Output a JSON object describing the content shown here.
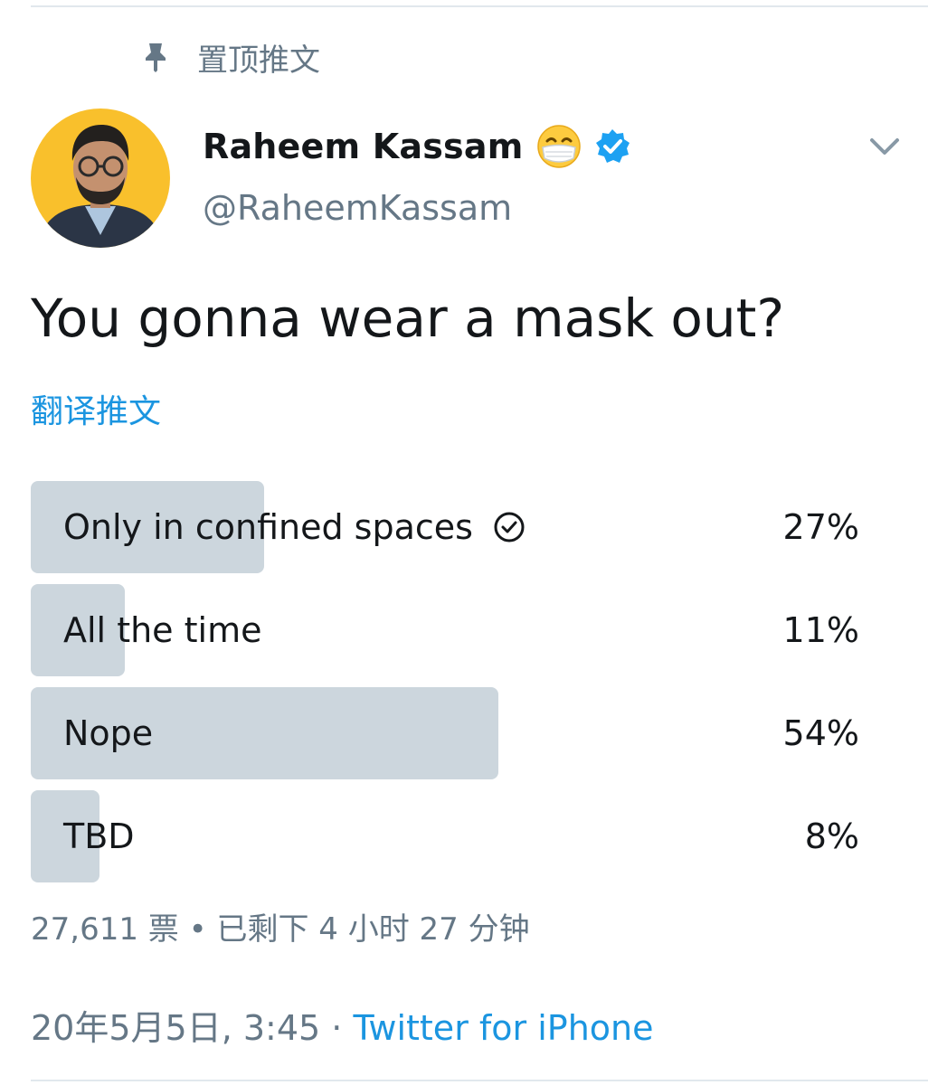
{
  "pinned": {
    "label": "置顶推文",
    "icon": "pin-icon"
  },
  "author": {
    "display_name": "Raheem Kassam",
    "handle": "@RaheemKassam",
    "emoji": "face-with-medical-mask",
    "verified": true
  },
  "tweet": {
    "text": "You gonna wear a mask out?",
    "translate_label": "翻译推文"
  },
  "poll": {
    "options": [
      {
        "label": "Only in confined spaces",
        "percent_label": "27%",
        "fraction": 0.27,
        "voted": true
      },
      {
        "label": "All the time",
        "percent_label": "11%",
        "fraction": 0.11,
        "voted": false
      },
      {
        "label": "Nope",
        "percent_label": "54%",
        "fraction": 0.54,
        "voted": false
      },
      {
        "label": "TBD",
        "percent_label": "8%",
        "fraction": 0.08,
        "voted": false
      }
    ],
    "meta": "27,611 票 • 已剩下 4 小时 27 分钟"
  },
  "footer": {
    "timestamp": "20年5月5日, 3:45",
    "separator": " · ",
    "source": "Twitter for iPhone"
  },
  "colors": {
    "link": "#1b95e0",
    "secondary_text": "#657786",
    "poll_bar": "#ccd6dd",
    "verified": "#1da1f2",
    "avatar_background": "#f9c02c"
  }
}
